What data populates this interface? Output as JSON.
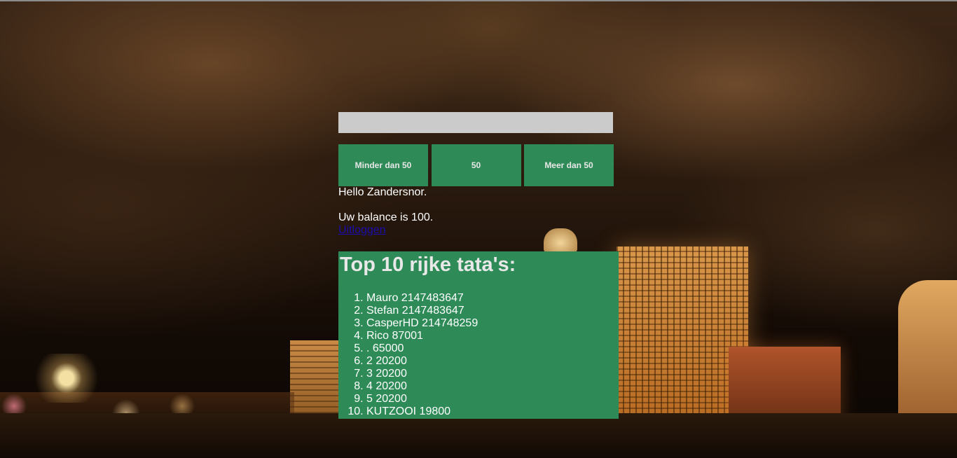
{
  "form": {
    "input_value": "",
    "buttons": [
      {
        "label": "Minder dan 50"
      },
      {
        "label": "50"
      },
      {
        "label": "Meer dan 50"
      }
    ],
    "button_color": "#2e8b57"
  },
  "user": {
    "greeting": "Hello Zandersnor.",
    "balance_text": "Uw balance is 100.",
    "logout_label": "Uitloggen"
  },
  "leaderboard": {
    "title": "Top 10 rijke tata's:",
    "entries": [
      "Mauro 2147483647",
      "Stefan 2147483647",
      "CasperHD 214748259",
      "Rico 87001",
      ". 65000",
      "2 20200",
      "3 20200",
      "4 20200",
      "5 20200",
      "KUTZOOI 19800"
    ],
    "bg_color": "#2e8b57"
  }
}
